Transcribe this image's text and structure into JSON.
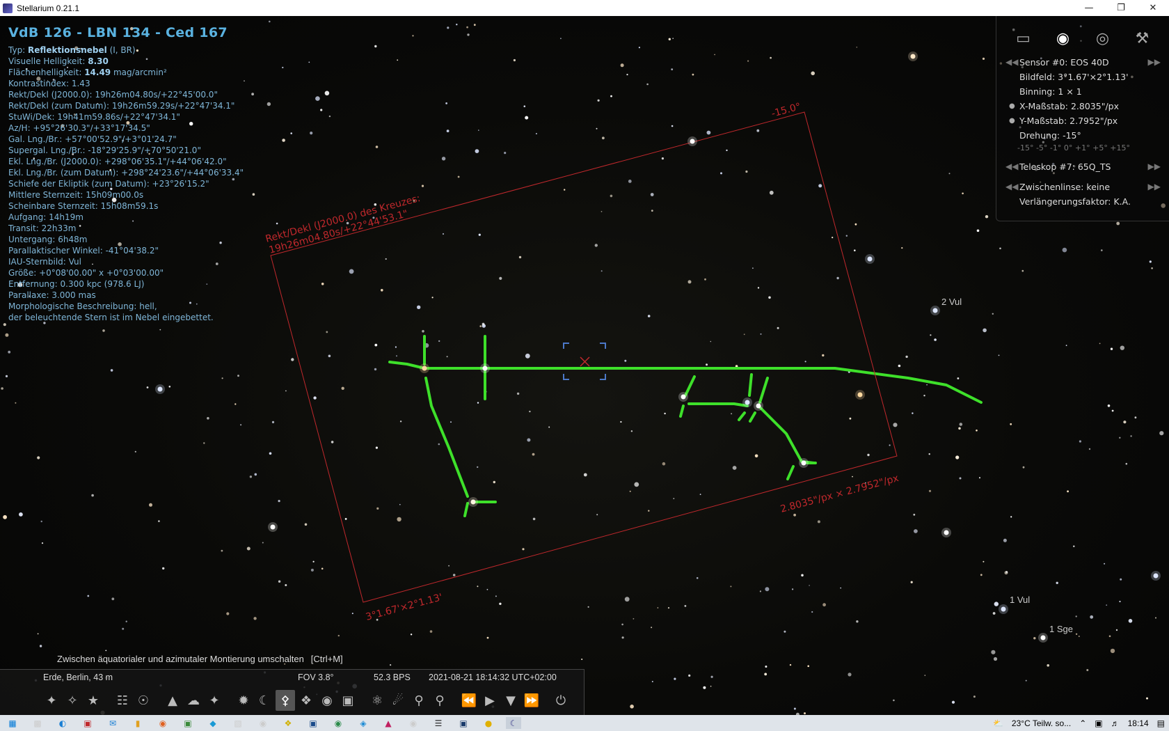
{
  "window": {
    "title": "Stellarium 0.21.1",
    "minimize": "—",
    "restore": "❐",
    "close": "✕"
  },
  "object": {
    "title": "VdB 126 - LBN 134 - Ced 167",
    "lines": [
      {
        "label": "Typ: ",
        "value": "Reflektionsnebel",
        "rest": " (I, BR)"
      },
      {
        "label": "Visuelle Helligkeit: ",
        "value": "8.30",
        "rest": ""
      },
      {
        "label": "Flächenhelligkeit: ",
        "value": "14.49",
        "rest": " mag/arcmin²"
      },
      {
        "label": "Kontrastindex: 1.43",
        "value": "",
        "rest": ""
      },
      {
        "label": "Rekt/Dekl (J2000.0): 19h26m04.80s/+22°45'00.0\"",
        "value": "",
        "rest": ""
      },
      {
        "label": "Rekt/Dekl (zum Datum): 19h26m59.29s/+22°47'34.1\"",
        "value": "",
        "rest": ""
      },
      {
        "label": "StuWi/Dek: 19h41m59.86s/+22°47'34.1\"",
        "value": "",
        "rest": ""
      },
      {
        "label": "Az/H: +95°26'30.3\"/+33°17'34.5\"",
        "value": "",
        "rest": ""
      },
      {
        "label": "Gal. Lng./Br.: +57°00'52.9\"/+3°01'24.7\"",
        "value": "",
        "rest": ""
      },
      {
        "label": "Supergal. Lng./Br.: -18°29'25.9\"/+70°50'21.0\"",
        "value": "",
        "rest": ""
      },
      {
        "label": "Ekl. Lng./Br. (J2000.0): +298°06'35.1\"/+44°06'42.0\"",
        "value": "",
        "rest": ""
      },
      {
        "label": "Ekl. Lng./Br. (zum Datum): +298°24'23.6\"/+44°06'33.4\"",
        "value": "",
        "rest": ""
      },
      {
        "label": "Schiefe der Ekliptik (zum Datum): +23°26'15.2\"",
        "value": "",
        "rest": ""
      },
      {
        "label": "Mittlere Sternzeit: 15h09m00.0s",
        "value": "",
        "rest": ""
      },
      {
        "label": "Scheinbare Sternzeit: 15h08m59.1s",
        "value": "",
        "rest": ""
      },
      {
        "label": "Aufgang: 14h19m",
        "value": "",
        "rest": ""
      },
      {
        "label": "Transit: 22h33m",
        "value": "",
        "rest": ""
      },
      {
        "label": "Untergang: 6h48m",
        "value": "",
        "rest": ""
      },
      {
        "label": "Parallaktischer Winkel: -41°04'38.2\"",
        "value": "",
        "rest": ""
      },
      {
        "label": "IAU-Sternbild: Vul",
        "value": "",
        "rest": ""
      },
      {
        "label": "Größe: +0°08'00.00\" x +0°03'00.00\"",
        "value": "",
        "rest": ""
      },
      {
        "label": "Entfernung: 0.300 kpc (978.6 LJ)",
        "value": "",
        "rest": ""
      },
      {
        "label": "Parallaxe: 3.000 mas",
        "value": "",
        "rest": ""
      },
      {
        "label": "Morphologische Beschreibung: hell,",
        "value": "",
        "rest": ""
      },
      {
        "label": "der beleuchtende Stern ist im Nebel eingebettet.",
        "value": "",
        "rest": ""
      }
    ]
  },
  "frame": {
    "rotation_label": "-15.0°",
    "center_label_1": "Rekt/Dekl (J2000.0) des Kreuzes:",
    "center_label_2": "19h26m04.80s/+22°44'53.1\"",
    "scale_label": "2.8035\"/px × 2.7952\"/px",
    "size_label": "3°1.67'×2°1.13'",
    "color": "#c0282c"
  },
  "star_labels": {
    "vul2": "2 Vul",
    "vul1": "1 Vul",
    "sge1": "1 Sge"
  },
  "oculars": {
    "sensor": "Sensor #0: EOS 40D",
    "field": "Bildfeld: 3°1.67'×2°1.13'",
    "binning": "Binning: 1 × 1",
    "xscale": "X-Maßstab: 2.8035\"/px",
    "yscale": "Y-Maßstab: 2.7952\"/px",
    "rotation": "Drehung: -15°",
    "rotation_steps": "-15° -5° -1° 0° +1° +5° +15°",
    "telescope": "Teleskop #7: 65Q_TS",
    "lens": "Zwischenlinse: keine",
    "extension": "Verlängerungsfaktor: K.A."
  },
  "hint": {
    "text": "Zwischen äquatorialer und azimutaler Montierung umschalten",
    "shortcut": "[Ctrl+M]"
  },
  "status": {
    "location": "Erde, Berlin, 43 m",
    "fov": "FOV 3.8°",
    "fps": "52.3 BPS",
    "datetime": "2021-08-21 18:14:32 UTC+02:00"
  },
  "taskbar": {
    "weather": "23°C  Teilw. so...",
    "time": "18:14"
  },
  "colors": {
    "constellation": "#3ee02a",
    "info_text": "#7fb6d8"
  }
}
